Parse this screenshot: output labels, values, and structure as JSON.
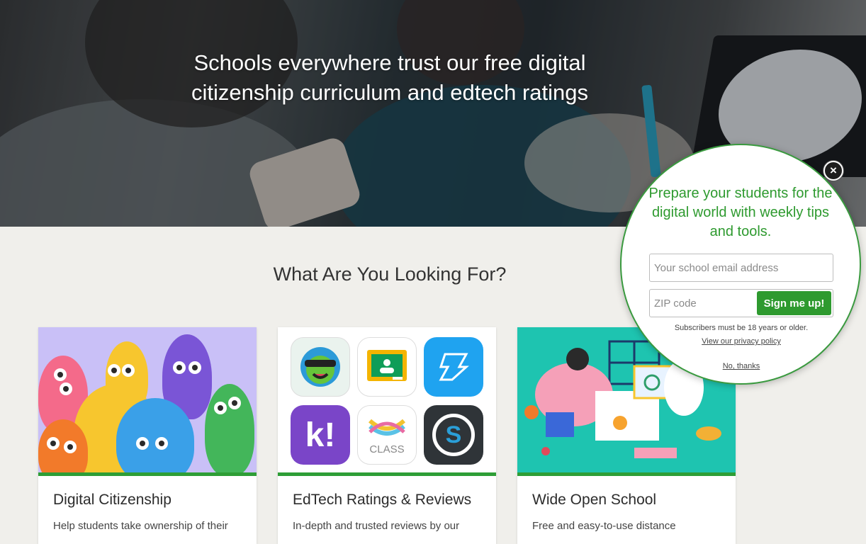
{
  "hero": {
    "title": "Schools everywhere trust our free digital citizenship curriculum and edtech ratings"
  },
  "section": {
    "title": "What Are You Looking For?"
  },
  "cards": [
    {
      "title": "Digital Citizenship",
      "description": "Help students take ownership of their"
    },
    {
      "title": "EdTech Ratings & Reviews",
      "description": "In-depth and trusted reviews by our"
    },
    {
      "title": "Wide Open School",
      "description": "Free and easy-to-use distance"
    }
  ],
  "apps": {
    "k_label": "k!",
    "class_label": "CLASS",
    "s_label": "S"
  },
  "popup": {
    "close_glyph": "×",
    "heading": "Prepare your students for the digital world with weekly tips and tools.",
    "email_placeholder": "Your school email address",
    "zip_placeholder": "ZIP code",
    "signup_label": "Sign me up!",
    "age_note": "Subscribers must be 18 years or older.",
    "privacy_link": "View our privacy policy",
    "no_thanks": "No, thanks"
  },
  "colors": {
    "accent_green": "#2e9a2f",
    "card_bar_green": "#2e9e36",
    "page_bg": "#f0efeb"
  }
}
